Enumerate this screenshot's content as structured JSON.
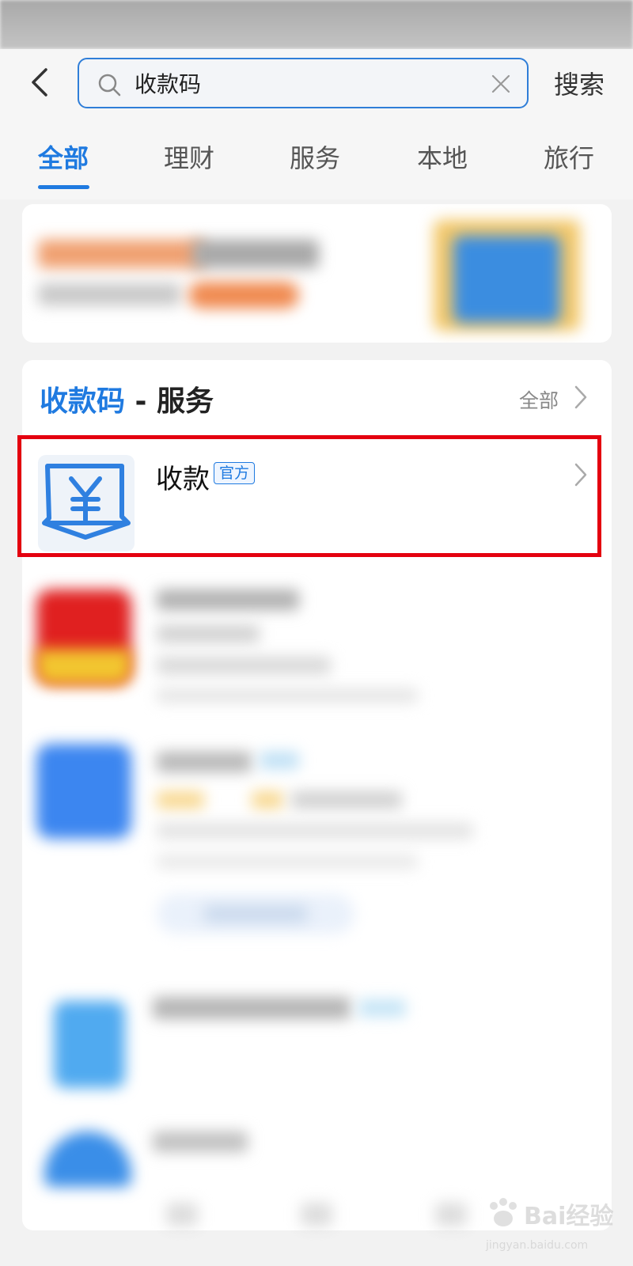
{
  "header": {
    "search_query": "收款码",
    "search_button": "搜索"
  },
  "tabs": [
    {
      "label": "全部",
      "active": true
    },
    {
      "label": "理财",
      "active": false
    },
    {
      "label": "服务",
      "active": false
    },
    {
      "label": "本地",
      "active": false
    },
    {
      "label": "旅行",
      "active": false
    }
  ],
  "section": {
    "keyword": "收款码",
    "title_suffix": " - 服务",
    "view_all": "全部"
  },
  "service": {
    "name": "收款",
    "badge": "官方",
    "icon": "yuan-receipt-icon"
  },
  "watermark": {
    "text": "Bai经验",
    "sub": "jingyan.baidu.com"
  },
  "colors": {
    "accent": "#1f7ae0",
    "highlight": "#e4000f"
  }
}
